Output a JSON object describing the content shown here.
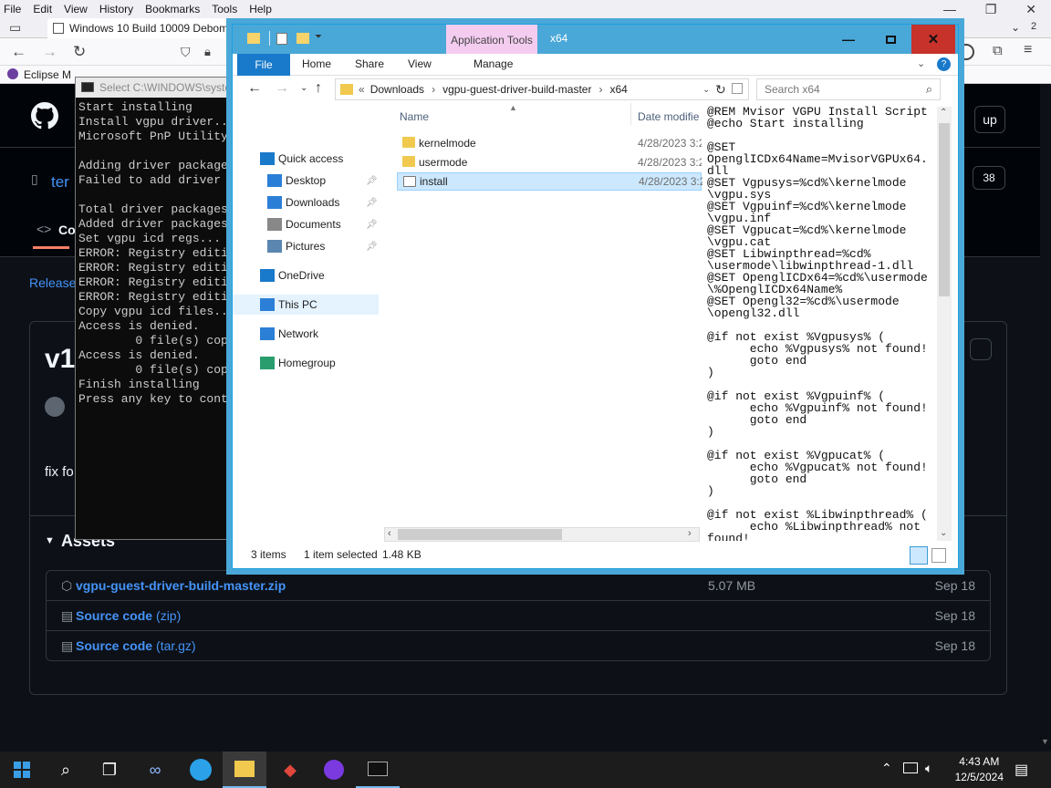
{
  "firefox": {
    "menu": [
      "File",
      "Edit",
      "View",
      "History",
      "Bookmarks",
      "Tools",
      "Help"
    ],
    "tab_title": "Windows 10 Build 10009 Debom",
    "bookmark_label": "Eclipse M",
    "tabs_badge": "2"
  },
  "github": {
    "repo_name_partial": "ter",
    "code_tab_partial": "Co",
    "release_link_partial": "Release",
    "release_title_partial": "v1",
    "body_partial": "fix fo",
    "tab_count_partial": "38",
    "header_button_partial": "up",
    "assets_label": "Assets",
    "assets": [
      {
        "name": "vgpu-guest-driver-build-master.zip",
        "ext": "",
        "size": "5.07 MB",
        "date": "Sep 18"
      },
      {
        "name": "Source code",
        "ext": "(zip)",
        "size": "",
        "date": "Sep 18"
      },
      {
        "name": "Source code",
        "ext": "(tar.gz)",
        "size": "",
        "date": "Sep 18"
      }
    ]
  },
  "cmd": {
    "title": "Select C:\\WINDOWS\\syste",
    "lines": [
      "Start installing",
      "Install vgpu driver..",
      "Microsoft PnP Utility",
      "",
      "Adding driver package",
      "Failed to add driver ",
      "",
      "Total driver packages",
      "Added driver packages",
      "Set vgpu icd regs...",
      "ERROR: Registry editi",
      "ERROR: Registry editi",
      "ERROR: Registry editi",
      "ERROR: Registry editi",
      "Copy vgpu icd files..",
      "Access is denied.",
      "        0 file(s) cop",
      "Access is denied.",
      "        0 file(s) cop",
      "Finish installing",
      "Press any key to cont"
    ]
  },
  "explorer": {
    "window_title": "x64",
    "app_tools": "Application Tools",
    "ribbon_tabs": [
      "File",
      "Home",
      "Share",
      "View",
      "Manage"
    ],
    "breadcrumb": [
      "Downloads",
      "vgpu-guest-driver-build-master",
      "x64"
    ],
    "search_placeholder": "Search x64",
    "nav": [
      {
        "label": "Quick access",
        "icon": "star-icon",
        "pinned": false
      },
      {
        "label": "Desktop",
        "icon": "desktop-icon",
        "pinned": true
      },
      {
        "label": "Downloads",
        "icon": "download-icon",
        "pinned": true
      },
      {
        "label": "Documents",
        "icon": "documents-icon",
        "pinned": true
      },
      {
        "label": "Pictures",
        "icon": "pictures-icon",
        "pinned": true
      },
      {
        "label": "OneDrive",
        "icon": "cloud-icon",
        "pinned": false
      },
      {
        "label": "This PC",
        "icon": "computer-icon",
        "pinned": false
      },
      {
        "label": "Network",
        "icon": "network-icon",
        "pinned": false
      },
      {
        "label": "Homegroup",
        "icon": "homegroup-icon",
        "pinned": false
      }
    ],
    "columns": {
      "name": "Name",
      "date": "Date modifie"
    },
    "files": [
      {
        "name": "kernelmode",
        "date": "4/28/2023 3:2",
        "type": "folder"
      },
      {
        "name": "usermode",
        "date": "4/28/2023 3:2",
        "type": "folder"
      },
      {
        "name": "install",
        "date": "4/28/2023 3:2",
        "type": "script",
        "selected": true
      }
    ],
    "preview_lines": [
      "@REM Mvisor VGPU Install Script",
      "@echo Start installing",
      "",
      "@SET",
      "OpenglICDx64Name=MvisorVGPUx64.",
      "dll",
      "@SET Vgpusys=%cd%\\kernelmode",
      "\\vgpu.sys",
      "@SET Vgpuinf=%cd%\\kernelmode",
      "\\vgpu.inf",
      "@SET Vgpucat=%cd%\\kernelmode",
      "\\vgpu.cat",
      "@SET Libwinpthread=%cd%",
      "\\usermode\\libwinpthread-1.dll",
      "@SET OpenglICDx64=%cd%\\usermode",
      "\\%OpenglICDx64Name%",
      "@SET Opengl32=%cd%\\usermode",
      "\\opengl32.dll",
      "",
      "@if not exist %Vgpusys% (",
      "      echo %Vgpusys% not found!",
      "      goto end",
      ")",
      "",
      "@if not exist %Vgpuinf% (",
      "      echo %Vgpuinf% not found!",
      "      goto end",
      ")",
      "",
      "@if not exist %Vgpucat% (",
      "      echo %Vgpucat% not found!",
      "      goto end",
      ")",
      "",
      "@if not exist %Libwinpthread% (",
      "      echo %Libwinpthread% not",
      "found!"
    ],
    "status": {
      "count": "3 items",
      "selected": "1 item selected",
      "size": "1.48 KB"
    }
  },
  "taskbar": {
    "time": "4:43 AM",
    "date": "12/5/2024"
  }
}
